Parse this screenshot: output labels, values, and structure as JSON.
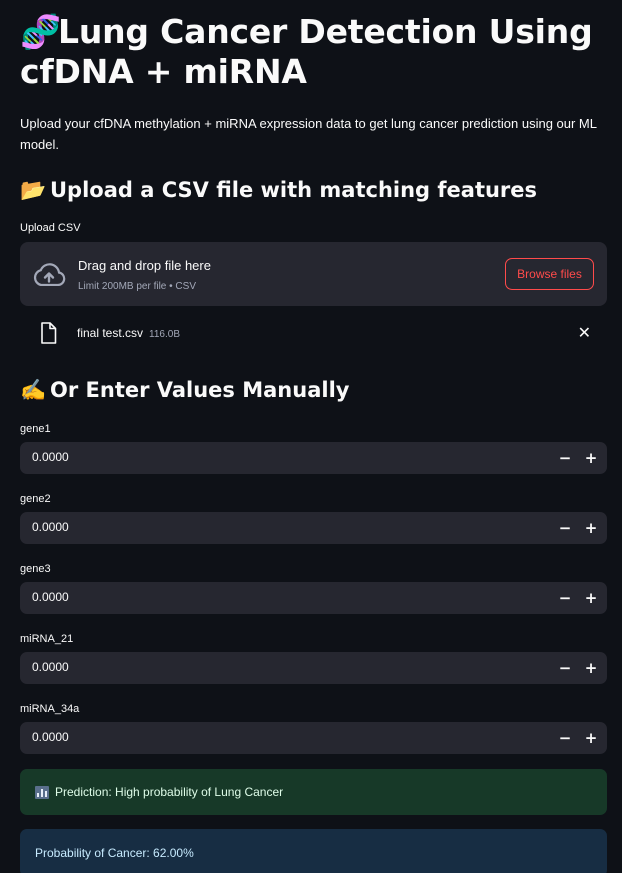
{
  "header": {
    "title_emoji": "🧬",
    "title": "Lung Cancer Detection Using cfDNA + miRNA",
    "intro": "Upload your cfDNA methylation + miRNA expression data to get lung cancer prediction using our ML model."
  },
  "upload_section": {
    "heading_emoji": "📂",
    "heading": "Upload a CSV file with matching features",
    "uploader_label": "Upload CSV",
    "drop_text": "Drag and drop file here",
    "limit_text": "Limit 200MB per file • CSV",
    "browse_label": "Browse files",
    "uploaded_file": {
      "name": "final test.csv",
      "size": "116.0B"
    }
  },
  "manual_section": {
    "heading_emoji": "✍️",
    "heading": "Or Enter Values Manually",
    "fields": [
      {
        "label": "gene1",
        "value": "0.0000"
      },
      {
        "label": "gene2",
        "value": "0.0000"
      },
      {
        "label": "gene3",
        "value": "0.0000"
      },
      {
        "label": "miRNA_21",
        "value": "0.0000"
      },
      {
        "label": "miRNA_34a",
        "value": "0.0000"
      }
    ],
    "minus_symbol": "−",
    "plus_symbol": "+"
  },
  "results": {
    "prediction": "Prediction: High probability of Lung Cancer",
    "probability": "Probability of Cancer: 62.00%"
  },
  "colors": {
    "background": "#0e1117",
    "widget": "#262730",
    "accent": "#ff4b4b",
    "success_bg": "#173928",
    "info_bg": "#172d43"
  }
}
